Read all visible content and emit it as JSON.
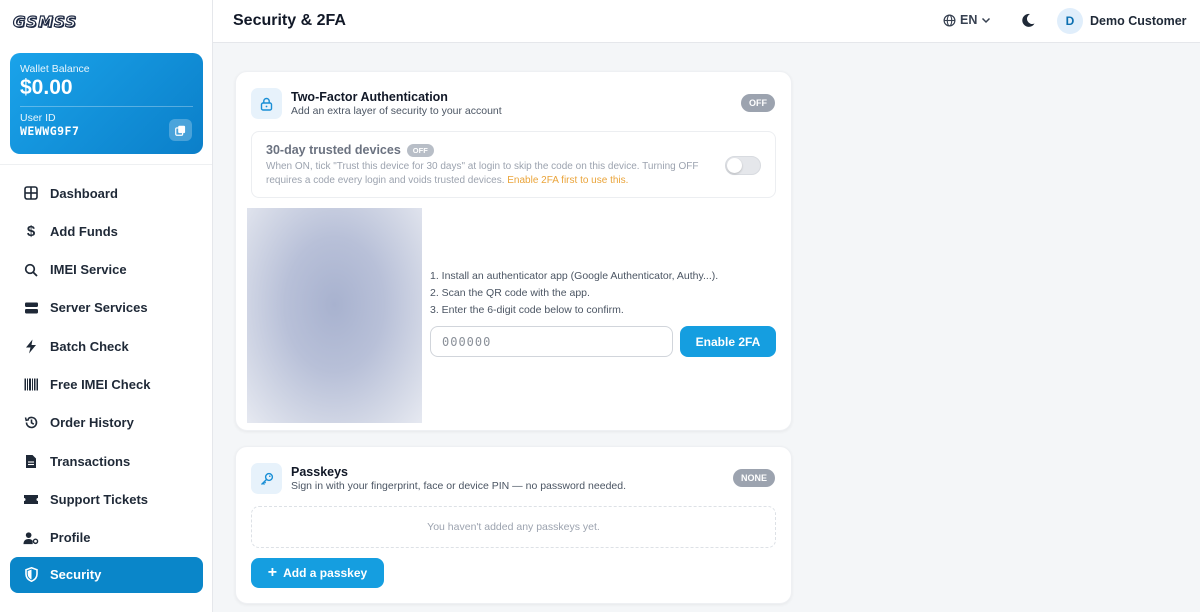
{
  "logo": {
    "text": "GSMSS"
  },
  "wallet": {
    "balance_label": "Wallet Balance",
    "balance": "$0.00",
    "user_id_label": "User ID",
    "user_id": "WEWWG9F7"
  },
  "sidebar": {
    "items": [
      {
        "label": "Dashboard",
        "icon": "grid-icon"
      },
      {
        "label": "Add Funds",
        "icon": "dollar-icon"
      },
      {
        "label": "IMEI Service",
        "icon": "search-icon"
      },
      {
        "label": "Server Services",
        "icon": "server-icon"
      },
      {
        "label": "Batch Check",
        "icon": "bolt-icon"
      },
      {
        "label": "Free IMEI Check",
        "icon": "barcode-icon"
      },
      {
        "label": "Order History",
        "icon": "history-icon"
      },
      {
        "label": "Transactions",
        "icon": "document-icon"
      },
      {
        "label": "Support Tickets",
        "icon": "ticket-icon"
      },
      {
        "label": "Profile",
        "icon": "user-gear-icon"
      },
      {
        "label": "Security",
        "icon": "shield-icon",
        "active": true
      }
    ]
  },
  "header": {
    "title": "Security & 2FA",
    "language": "EN",
    "user_initial": "D",
    "user_name": "Demo Customer"
  },
  "two_factor": {
    "title": "Two-Factor Authentication",
    "subtitle": "Add an extra layer of security to your account",
    "status": "OFF",
    "trusted": {
      "title": "30-day trusted devices",
      "status": "OFF",
      "description": "When ON, tick \"Trust this device for 30 days\" at login to skip the code on this device. Turning OFF requires a code every login and voids trusted devices.",
      "warning": "Enable 2FA first to use this.",
      "toggle_on": false
    },
    "steps": [
      "1. Install an authenticator app (Google Authenticator, Authy...).",
      "2. Scan the QR code with the app.",
      "3. Enter the 6-digit code below to confirm."
    ],
    "code_placeholder": "000000",
    "enable_label": "Enable 2FA"
  },
  "passkeys": {
    "title": "Passkeys",
    "subtitle": "Sign in with your fingerprint, face or device PIN — no password needed.",
    "status": "NONE",
    "empty_text": "You haven't added any passkeys yet.",
    "add_label": "Add a passkey"
  },
  "colors": {
    "accent": "#159ee0",
    "active_nav": "#0a86c9",
    "warning": "#eaa43a",
    "pill_gray": "#9ca3af"
  }
}
